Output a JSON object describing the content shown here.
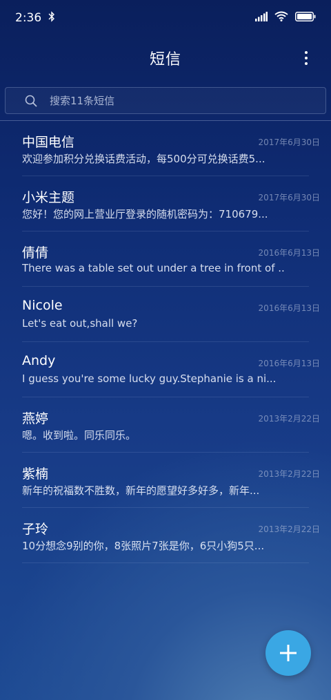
{
  "status_bar": {
    "time": "2:36",
    "icons": [
      "bluetooth-icon",
      "signal-icon",
      "wifi-icon",
      "battery-icon"
    ]
  },
  "header": {
    "title": "短信",
    "menu_icon": "more-vert-icon"
  },
  "search": {
    "placeholder": "搜索11条短信",
    "icon": "search-icon"
  },
  "messages": [
    {
      "name": "中国电信",
      "date": "2017年6月30日",
      "preview": "欢迎参加积分兑换话费活动，每500分可兑换话费5..."
    },
    {
      "name": "小米主题",
      "date": "2017年6月30日",
      "preview": "您好！您的网上营业厅登录的随机密码为：710679..."
    },
    {
      "name": "倩倩",
      "date": "2016年6月13日",
      "preview": "There was a table set out under a tree in front of ..."
    },
    {
      "name": "Nicole",
      "date": "2016年6月13日",
      "preview": "Let's eat out,shall we?"
    },
    {
      "name": "Andy",
      "date": "2016年6月13日",
      "preview": "I guess you're some lucky guy.Stephanie is a ni..."
    },
    {
      "name": "燕婷",
      "date": "2013年2月22日",
      "preview": "嗯。收到啦。同乐同乐。"
    },
    {
      "name": "紫楠",
      "date": "2013年2月22日",
      "preview": "新年的祝福数不胜数，新年的愿望好多好多，新年..."
    },
    {
      "name": "子玲",
      "date": "2013年2月22日",
      "preview": "10分想念9别的你，8张照片7张是你，6只小狗5只..."
    }
  ],
  "fab": {
    "icon": "plus-icon"
  },
  "colors": {
    "accent": "#3aa7e4",
    "background_top": "#0a1f5c",
    "background_bottom": "#1d4a93"
  }
}
